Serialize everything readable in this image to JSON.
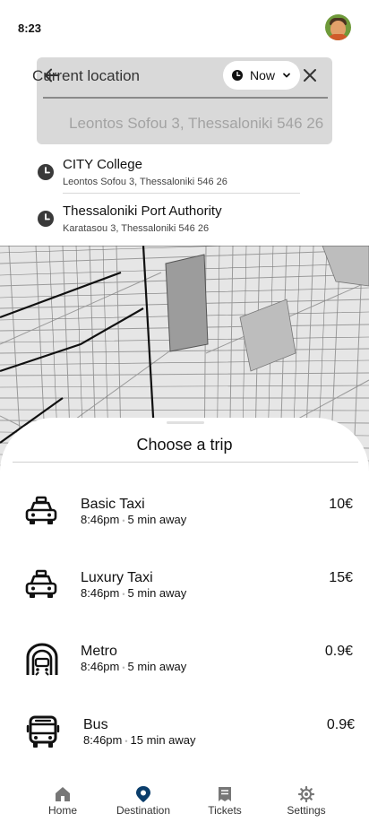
{
  "status_bar": {
    "time": "8:23"
  },
  "search": {
    "origin_label": "Current location",
    "time_option": "Now",
    "destination_value": "Leontos Sofou 3, Thessaloniki 546 26"
  },
  "recent": [
    {
      "name": "CITY College",
      "address": "Leontos Sofou 3, Thessaloniki 546 26"
    },
    {
      "name": "Thessaloniki Port Authority",
      "address": "Karatasou 3, Thessaloniki 546 26"
    }
  ],
  "sheet": {
    "title": "Choose a trip"
  },
  "trips": [
    {
      "name": "Basic Taxi",
      "time": "8:46pm",
      "eta": "5 min away",
      "price": "10€",
      "icon": "taxi-icon"
    },
    {
      "name": "Luxury Taxi",
      "time": "8:46pm",
      "eta": "5 min away",
      "price": "15€",
      "icon": "taxi-icon"
    },
    {
      "name": "Metro",
      "time": "8:46pm",
      "eta": "5 min away",
      "price": "0.9€",
      "icon": "metro-icon"
    },
    {
      "name": "Bus",
      "time": "8:46pm",
      "eta": "15 min away",
      "price": "0.9€",
      "icon": "bus-icon"
    }
  ],
  "nav": {
    "items": [
      {
        "label": "Home",
        "icon": "home-icon"
      },
      {
        "label": "Destination",
        "icon": "location-pin-icon",
        "active": true
      },
      {
        "label": "Tickets",
        "icon": "ticket-icon"
      },
      {
        "label": "Settings",
        "icon": "gear-icon"
      }
    ],
    "active_color": "#0a3d6b",
    "inactive_color": "#777777"
  }
}
